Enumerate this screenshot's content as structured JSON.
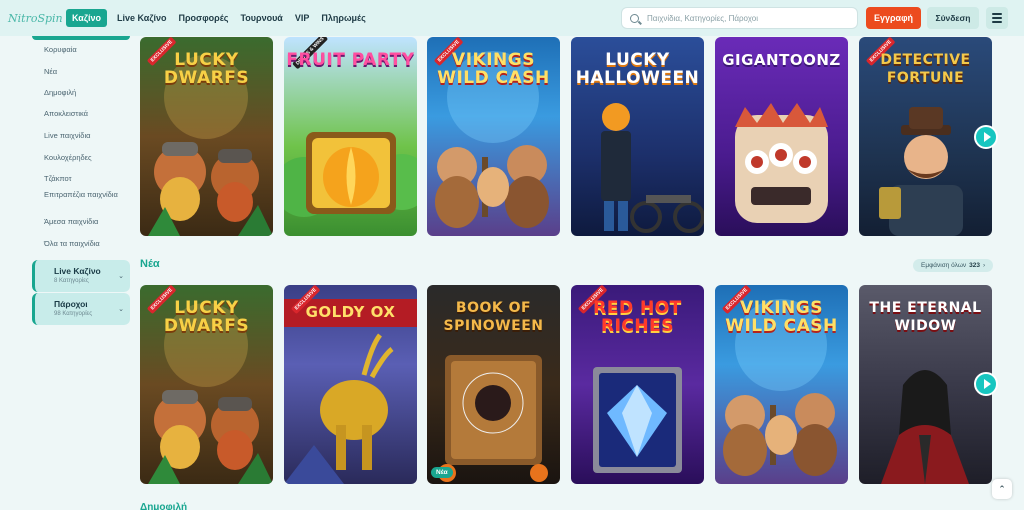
{
  "header": {
    "logo": "NitroSpin",
    "nav": [
      {
        "label": "Καζίνο",
        "active": true
      },
      {
        "label": "Live Καζίνο",
        "active": false
      },
      {
        "label": "Προσφορές",
        "active": false
      },
      {
        "label": "Τουρνουά",
        "active": false
      },
      {
        "label": "VIP",
        "active": false
      },
      {
        "label": "Πληρωμές",
        "active": false
      }
    ],
    "search_placeholder": "Παιχνίδια, Κατηγορίες, Πάροχοι",
    "register_label": "Εγγραφή",
    "login_label": "Σύνδεση"
  },
  "sidebar": {
    "items": [
      "Κορυφαία",
      "Νέα",
      "Δημοφιλή",
      "Αποκλειστικά",
      "Live παιχνίδια",
      "Κουλοχέρηδες",
      "Τζάκποτ",
      "Επιτραπέζια παιχνίδια",
      "Άμεσα παιχνίδια",
      "Όλα τα παιχνίδια"
    ],
    "cards": [
      {
        "title": "Live Καζίνο",
        "sub": "8 Κατηγορίες"
      },
      {
        "title": "Πάροχοι",
        "sub": "98 Κατηγορίες"
      }
    ]
  },
  "row1": [
    {
      "title": "LUCKY DWARFS",
      "badge": "EXCLUSIVE",
      "theme": "dwarfs"
    },
    {
      "title": "FRUIT PARTY",
      "badge": "DROPS & WINS",
      "theme": "fruit"
    },
    {
      "title": "VIKINGS WILD CASH",
      "badge": "EXCLUSIVE",
      "theme": "vikings"
    },
    {
      "title": "LUCKY HALLOWEEN",
      "badge": "",
      "theme": "halloween"
    },
    {
      "title": "GIGANTOONZ",
      "badge": "",
      "theme": "gigantoonz"
    },
    {
      "title": "DETECTIVE FORTUNE",
      "badge": "EXCLUSIVE",
      "theme": "detective"
    }
  ],
  "section_new": {
    "title": "Νέα",
    "view_all_label": "Εμφάνιση όλων",
    "count": "323"
  },
  "row2": [
    {
      "title": "LUCKY DWARFS",
      "badge": "EXCLUSIVE",
      "theme": "dwarfs"
    },
    {
      "title": "GOLDY OX",
      "badge": "EXCLUSIVE",
      "theme": "ox"
    },
    {
      "title": "BOOK OF SPINOWEEN",
      "badge": "",
      "theme": "book",
      "new_label": "Νέα"
    },
    {
      "title": "RED HOT RICHES",
      "badge": "EXCLUSIVE",
      "theme": "redhot"
    },
    {
      "title": "VIKINGS WILD CASH",
      "badge": "EXCLUSIVE",
      "theme": "vikings"
    },
    {
      "title": "THE ETERNAL WIDOW",
      "badge": "",
      "theme": "widow"
    }
  ],
  "section_next": {
    "title": "Δημοφιλή"
  },
  "colors": {
    "accent": "#19a690",
    "register": "#ec4b1e",
    "background": "#eef7f7"
  }
}
